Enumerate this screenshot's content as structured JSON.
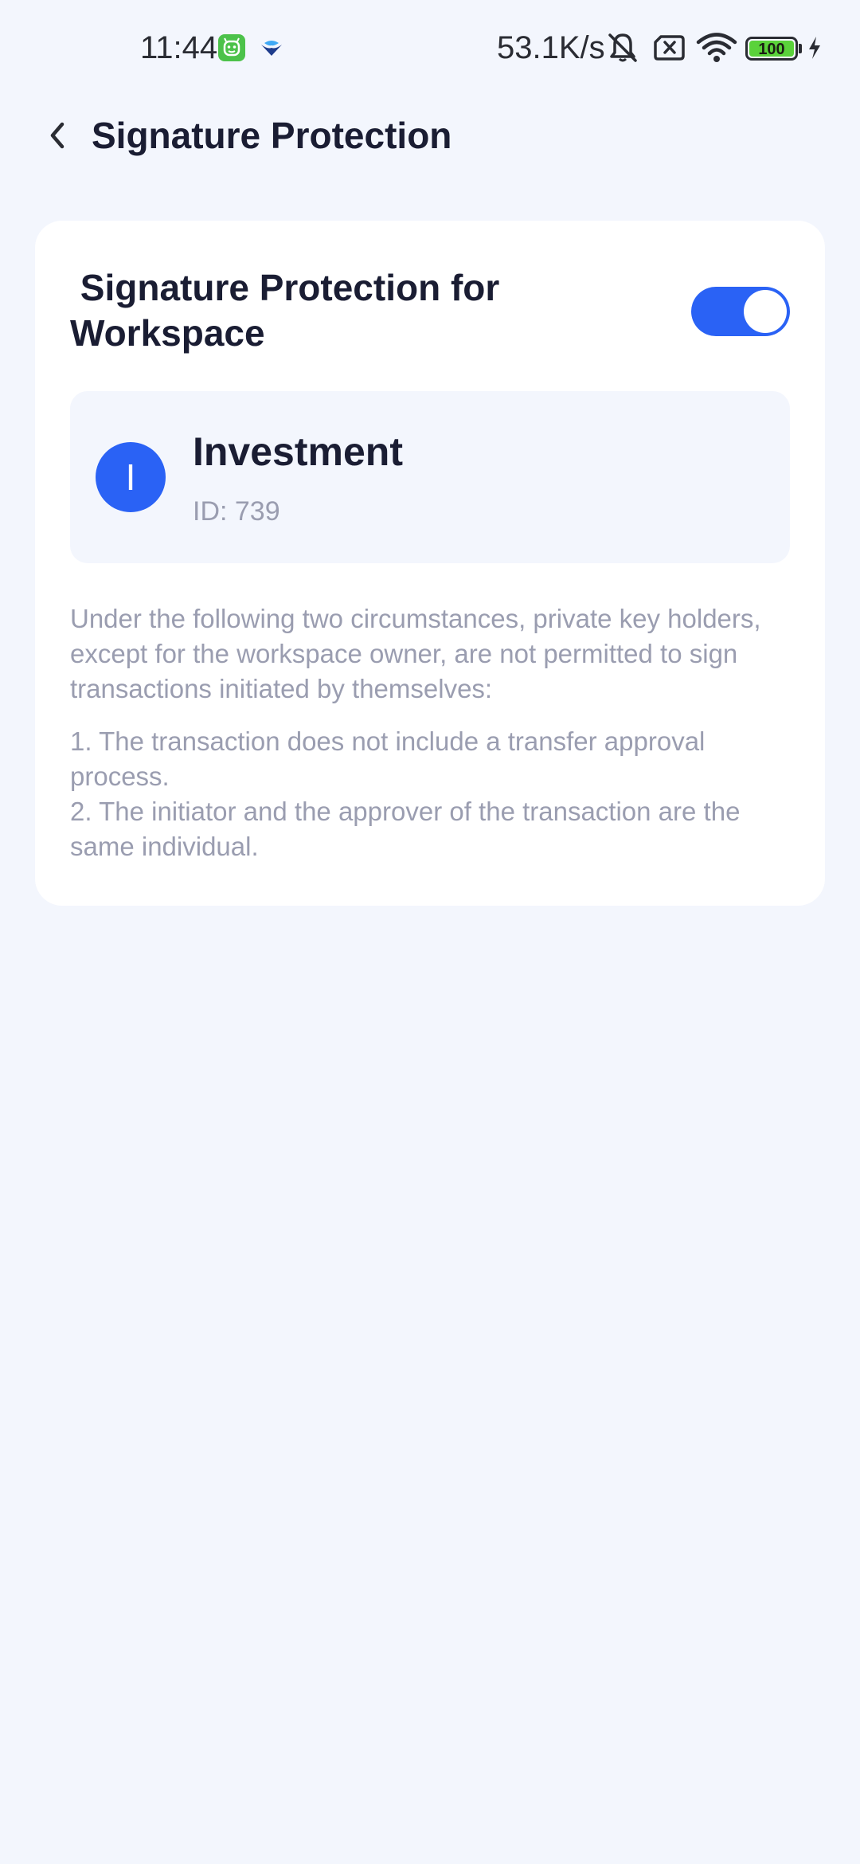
{
  "status_bar": {
    "time": "11:44",
    "network_speed": "53.1K/s",
    "battery_level": "100",
    "icons": [
      "app-notification-icon",
      "app-notification-icon-2",
      "mute-icon",
      "sim-off-icon",
      "wifi-icon",
      "battery-icon",
      "charging-icon"
    ]
  },
  "header": {
    "title": "Signature Protection",
    "back_icon": "chevron-left-icon"
  },
  "setting": {
    "title": " Signature Protection for Workspace",
    "toggle_on": true,
    "toggle_color": "#2a62f5"
  },
  "workspace": {
    "avatar_letter": "I",
    "name": "Investment",
    "id_label": "ID: 739"
  },
  "description": {
    "intro": "Under the following two circumstances, private key holders, except for the workspace owner, are not permitted to sign transactions initiated by themselves:",
    "items": [
      "1. The transaction does not include a transfer approval process.",
      "2. The initiator and the approver of the transaction are the same individual."
    ]
  },
  "colors": {
    "background": "#f3f6fd",
    "card": "#ffffff",
    "accent": "#2a62f5",
    "text_primary": "#1a1d33",
    "text_secondary": "#9a9db0"
  }
}
